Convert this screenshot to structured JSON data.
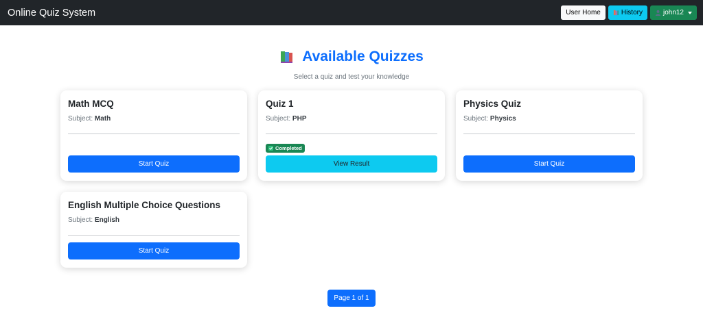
{
  "navbar": {
    "brand": "Online Quiz System",
    "user_home_label": "User Home",
    "history_label": "History",
    "user_label": "john12"
  },
  "header": {
    "title": "Available Quizzes",
    "subtitle": "Select a quiz and test your knowledge"
  },
  "quizzes": [
    {
      "title": "Math MCQ",
      "subject_label": "Subject:",
      "subject": "Math",
      "action": "Start Quiz"
    },
    {
      "title": "Quiz 1",
      "subject_label": "Subject:",
      "subject": "PHP",
      "status": "Completed",
      "action": "View Result"
    },
    {
      "title": "Physics Quiz",
      "subject_label": "Subject:",
      "subject": "Physics",
      "action": "Start Quiz"
    },
    {
      "title": "English Multiple Choice Questions",
      "subject_label": "Subject:",
      "subject": "English",
      "action": "Start Quiz"
    }
  ],
  "pagination": {
    "label": "Page 1 of 1"
  },
  "colors": {
    "primary": "#0d6efd",
    "info": "#0dcaf0",
    "success": "#198754",
    "navbar": "#212529"
  }
}
